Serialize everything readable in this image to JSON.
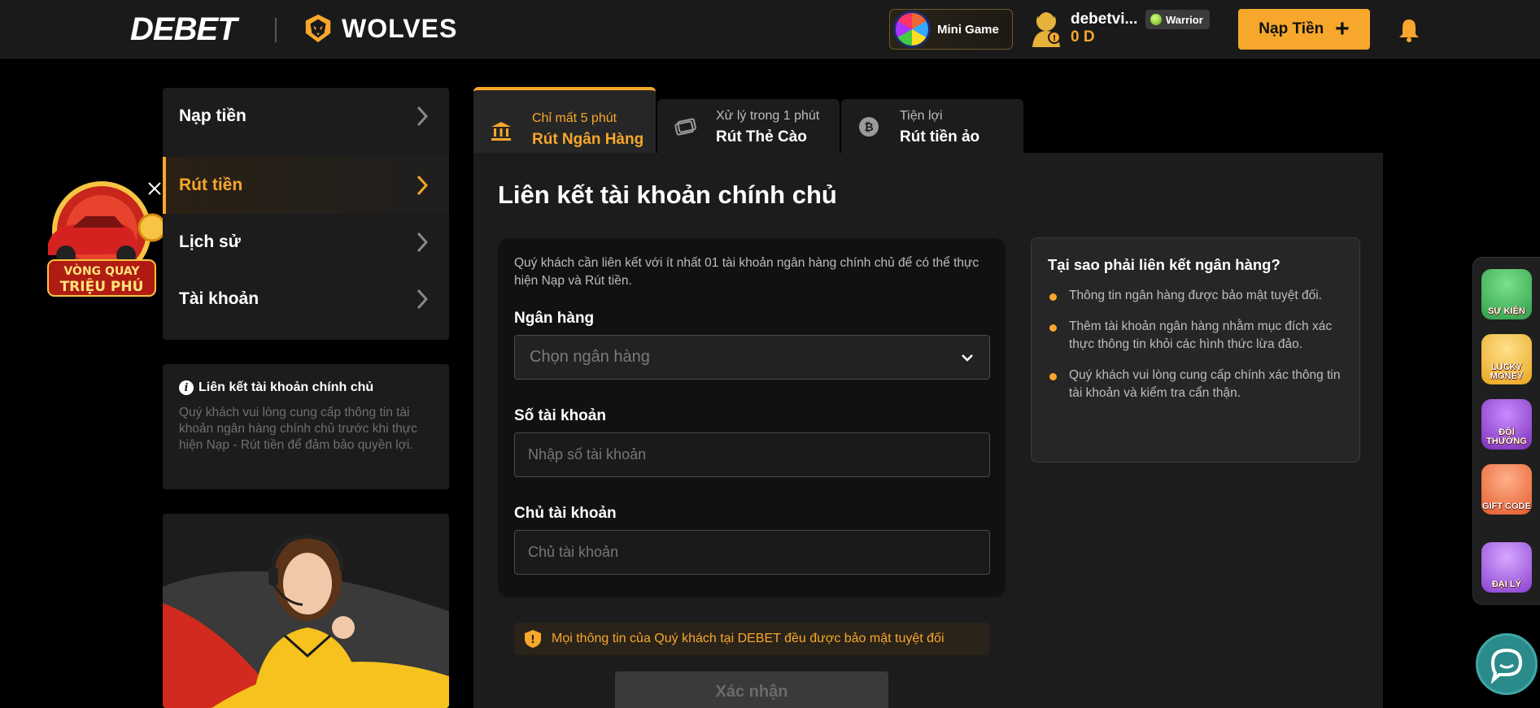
{
  "header": {
    "logo_text": "DEBET",
    "partner_text": "WOLVES",
    "minigame_label": "Mini Game",
    "username": "debetvi...",
    "balance": "0 D",
    "rank": "Warrior",
    "deposit_label": "Nạp Tiền",
    "deposit_plus": "+"
  },
  "sidebar": {
    "items": [
      {
        "label": "Nạp tiền"
      },
      {
        "label": "Rút tiền"
      },
      {
        "label": "Lịch sử"
      },
      {
        "label": "Tài khoản"
      }
    ],
    "info_title": "Liên kết tài khoản chính chủ",
    "info_text": "Quý khách vui lòng cung cấp thông tin tài khoản ngân hàng chính chủ trước khi thực hiện Nạp - Rút tiền để đảm bảo quyền lợi."
  },
  "promo": {
    "line1": "VÒNG QUAY",
    "line2": "TRIỆU PHÚ"
  },
  "tabs": [
    {
      "sub": "Chỉ mất 5 phút",
      "main": "Rút Ngân Hàng"
    },
    {
      "sub": "Xử lý trong 1 phút",
      "main": "Rút Thẻ Cào"
    },
    {
      "sub": "Tiện lợi",
      "main": "Rút tiền ảo"
    }
  ],
  "main": {
    "title": "Liên kết tài khoản chính chủ",
    "note": "Quý khách cần liên kết với ít nhất 01 tài khoản ngân hàng chính chủ để có thể thực hiện Nạp và Rút tiền.",
    "bank_label": "Ngân hàng",
    "bank_placeholder": "Chọn ngân hàng",
    "account_label": "Số tài khoản",
    "account_placeholder": "Nhập số tài khoản",
    "holder_label": "Chủ tài khoản",
    "holder_placeholder": "Chủ tài khoản",
    "security_text": "Mọi thông tin của Quý khách tại DEBET đều được bảo mật tuyệt đối",
    "confirm_label": "Xác nhận"
  },
  "why": {
    "title": "Tại sao phải liên kết ngân hàng?",
    "items": [
      "Thông tin ngân hàng được bảo mật tuyệt đối.",
      "Thêm tài khoản ngân hàng nhằm mục đích xác thực thông tin khỏi các hình thức lừa đảo.",
      "Quý khách vui lòng cung cấp chính xác thông tin tài khoản và kiểm tra cẩn thận."
    ]
  },
  "rail": {
    "items": [
      {
        "label": "SỰ KIỆN",
        "color": "#2f9d4a"
      },
      {
        "label": "LUCKY MONEY",
        "color": "#e8a51f"
      },
      {
        "label": "ĐỔI THƯỞNG",
        "color": "#7a2fb8"
      },
      {
        "label": "GIFT CODE",
        "color": "#e35a2b"
      },
      {
        "label": "ĐẠI LÝ",
        "color": "#8a3fd0"
      }
    ]
  },
  "colors": {
    "accent": "#f7a72b",
    "panel": "#1c1c1c",
    "background": "#000000"
  }
}
